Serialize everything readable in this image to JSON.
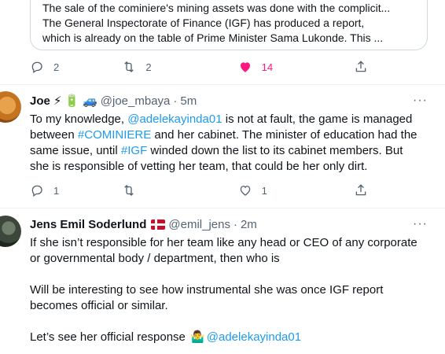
{
  "quote": {
    "line1": "The sale of the cominiere's mining assets was done with the complicit...",
    "line2": "The General Inspectorate of Finance (IGF) has produced a report,",
    "line3": "which is already on the table of Prime Minister Sama Lukonde. This ..."
  },
  "tweet_actions_top": {
    "reply_count": "2",
    "retweet_count": "2",
    "like_count": "14"
  },
  "tweet1": {
    "name": "Joe",
    "emojis": [
      "⚡",
      "🔋",
      "🚙"
    ],
    "handle": "@joe_mbaya",
    "sep": "·",
    "time": "5m",
    "text": {
      "l1a": "To my knowledge, ",
      "l1mention": "@adelekayinda01",
      "l1b": " is not at fault, the game is managed",
      "l2a": "between ",
      "l2hashtag": "#COMINIERE",
      "l2b": " and her cabinet. The minister of education had the",
      "l3a": "same issue, until ",
      "l3hashtag": "#IGF",
      "l3b": " winded down the list to its cabinet members. But",
      "l4": "she is responsible of vetting her team, that could be her only dirt."
    },
    "reply_count": "1",
    "like_count": "1"
  },
  "tweet2": {
    "name": "Jens Emil Soderlund",
    "flag": "denmark-flag",
    "handle": "@emil_jens",
    "sep": "·",
    "time": "2m",
    "text": {
      "l1": "If she isn’t responsible for her team like any head or CEO of any corporate",
      "l2": "or governmental body / department, then who is",
      "l3": "Will be interesting to see how instrumental she was once IGF report",
      "l4": "becomes official or similar.",
      "l5a": "Let’s see her official response ",
      "l5emoji": "🤷‍♂️",
      "l5mention": "@adelekayinda01"
    }
  },
  "more_label": "···",
  "colors": {
    "accent": "#1d9bf0",
    "like": "#f91880",
    "muted": "#536471"
  }
}
